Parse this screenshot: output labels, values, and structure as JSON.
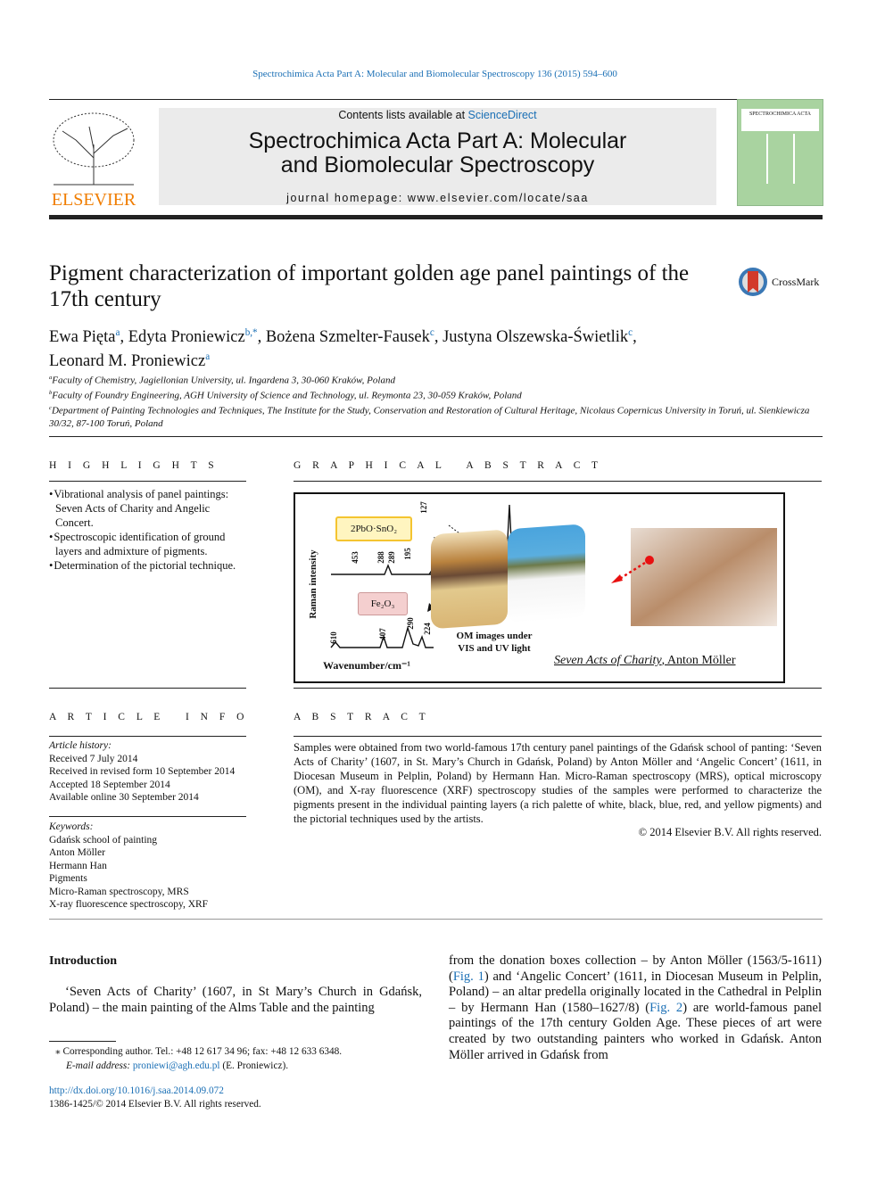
{
  "header": {
    "journal_ref": "Spectrochimica Acta Part A: Molecular and Biomolecular Spectroscopy 136 (2015) 594–600",
    "contents_prefix": "Contents lists available at ",
    "contents_link": "ScienceDirect",
    "journal_title": "Spectrochimica Acta Part A: Molecular and Biomolecular Spectroscopy",
    "homepage_prefix": "journal homepage: ",
    "homepage_url": "www.elsevier.com/locate/saa",
    "publisher_logo": "ELSEVIER",
    "cover_title": "SPECTROCHIMICA ACTA",
    "crossmark": "CrossMark"
  },
  "article": {
    "title": "Pigment characterization of important golden age panel paintings of the 17th century",
    "authors": [
      {
        "name": "Ewa Pięta",
        "sup": "a",
        "sep": ", "
      },
      {
        "name": "Edyta Proniewicz",
        "sup": "b,*",
        "sep": ", "
      },
      {
        "name": "Bożena Szmelter-Fausek",
        "sup": "c",
        "sep": ", "
      },
      {
        "name": "Justyna Olszewska-Świetlik",
        "sup": "c",
        "sep": ","
      },
      {
        "name": "Leonard M. Proniewicz",
        "sup": "a",
        "sep": ""
      }
    ],
    "affiliations": [
      {
        "sup": "a",
        "text": "Faculty of Chemistry, Jagiellonian University, ul. Ingardena 3, 30-060 Kraków, Poland"
      },
      {
        "sup": "b",
        "text": "Faculty of Foundry Engineering, AGH University of Science and Technology, ul. Reymonta 23, 30-059 Kraków, Poland"
      },
      {
        "sup": "c",
        "text": "Department of Painting Technologies and Techniques, The Institute for the Study, Conservation and Restoration of Cultural Heritage, Nicolaus Copernicus University in Toruń, ul. Sienkiewicza 30/32, 87-100 Toruń, Poland"
      }
    ]
  },
  "highlights": {
    "heading": "H I G H L I G H T S",
    "items": [
      "Vibrational analysis of panel paintings: Seven Acts of Charity and Angelic Concert.",
      "Spectroscopic identification of ground layers and admixture of pigments.",
      "Determination of the pictorial technique."
    ]
  },
  "graphical_abstract": {
    "heading": "G R A P H I C A L   A B S T R A C T",
    "label_pbo": "2PbO·SnO₂",
    "label_fe": "Fe₂O₃",
    "ylabel": "Raman intensity",
    "xlabel": "Wavenumber/cm⁻¹",
    "peaks_top": [
      "453",
      "288",
      "289",
      "195",
      "127"
    ],
    "peaks_bottom": [
      "610",
      "407",
      "290",
      "224"
    ],
    "om_caption_1": "OM images under",
    "om_caption_2": "VIS and UV light",
    "painting_title": "Seven Acts of Charity",
    "painting_author": ", Anton Möller"
  },
  "article_info": {
    "heading": "A R T I C L E   I N F O",
    "history_label": "Article history:",
    "history": [
      "Received 7 July 2014",
      "Received in revised form 10 September 2014",
      "Accepted 18 September 2014",
      "Available online 30 September 2014"
    ],
    "keywords_label": "Keywords:",
    "keywords": [
      "Gdańsk school of painting",
      "Anton Möller",
      "Hermann Han",
      "Pigments",
      "Micro-Raman spectroscopy, MRS",
      "X-ray fluorescence spectroscopy, XRF"
    ]
  },
  "abstract": {
    "heading": "A B S T R A C T",
    "text": "Samples were obtained from two world-famous 17th century panel paintings of the Gdańsk school of panting: ‘Seven Acts of Charity’ (1607, in St. Mary’s Church in Gdańsk, Poland) by Anton Möller and ‘Angelic Concert’ (1611, in Diocesan Museum in Pelplin, Poland) by Hermann Han. Micro-Raman spectroscopy (MRS), optical microscopy (OM), and X-ray fluorescence (XRF) spectroscopy studies of the samples were performed to characterize the pigments present in the individual painting layers (a rich palette of white, black, blue, red, and yellow pigments) and the pictorial techniques used by the artists.",
    "copyright": "© 2014 Elsevier B.V. All rights reserved."
  },
  "intro": {
    "heading": "Introduction",
    "left": "‘Seven Acts of Charity’ (1607, in St Mary’s Church in Gdańsk, Poland) – the main painting of the Alms Table and the painting",
    "right_1": "from the donation boxes collection – by Anton Möller (1563/5-1611) (",
    "fig1": "Fig. 1",
    "right_2": ") and ‘Angelic Concert’ (1611, in Diocesan Museum in Pelplin, Poland) – an altar predella originally located in the Cathedral in Pelplin – by Hermann Han (1580–1627/8) (",
    "fig2": "Fig. 2",
    "right_3": ") are world-famous panel paintings of the 17th century Golden Age. These pieces of art were created by two outstanding painters who worked in Gdańsk. Anton Möller arrived in Gdańsk from"
  },
  "footnote": {
    "corresponding": "⁎  Corresponding author. Tel.: +48 12 617 34 96; fax: +48 12 633 6348.",
    "email_label": "E-mail address: ",
    "email": "proniewi@agh.edu.pl",
    "email_suffix": " (E. Proniewicz)."
  },
  "doi": {
    "url": "http://dx.doi.org/10.1016/j.saa.2014.09.072",
    "issn": "1386-1425/© 2014 Elsevier B.V. All rights reserved."
  },
  "colors": {
    "link": "#1a6fb5",
    "elsevier_orange": "#f07d00",
    "cover_green": "#a9d3a0"
  }
}
